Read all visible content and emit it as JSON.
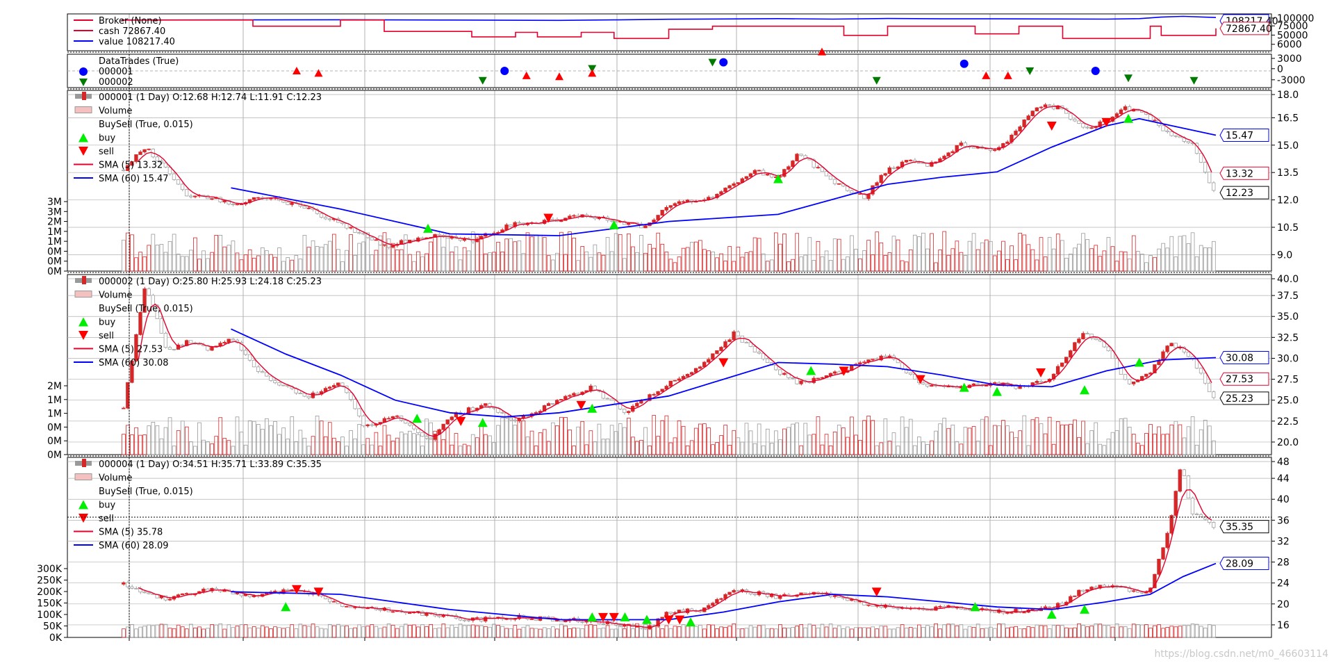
{
  "watermark": "https://blog.csdn.net/m0_46603114",
  "colors": {
    "up": "#d62728",
    "down": "#a0a0a0",
    "sma_fast": "#e4002b",
    "sma_slow": "#0000ff",
    "buy": "#00ee00",
    "sell": "#ff0000",
    "trade_buy": "#0000ff",
    "trade_sell": "#007a00",
    "cash": "#e4002b",
    "value": "#0000ff",
    "volume_up": "#d62728",
    "volume_down": "#999999",
    "grid": "#b0b0b0"
  },
  "chart_data": [
    {
      "type": "line",
      "panel": "broker",
      "legend": [
        "Broker (None)",
        "cash 72867.40",
        "value 108217.40"
      ],
      "yticks": [
        "100000",
        "75000",
        "50000",
        "6000"
      ],
      "ylim": [
        0,
        120000
      ],
      "last_labels": [
        "108217.40",
        "72867.40"
      ],
      "series": [
        {
          "name": "value",
          "x": [
            0,
            0.1,
            0.2,
            0.3,
            0.4,
            0.45,
            0.5,
            0.55,
            0.6,
            0.65,
            0.7,
            0.75,
            0.8,
            0.85,
            0.9,
            0.93,
            0.95,
            0.97,
            1.0
          ],
          "y": [
            100000,
            100500,
            101000,
            100000,
            99000,
            100500,
            102500,
            103500,
            104500,
            103000,
            105000,
            104000,
            104000,
            103500,
            103000,
            104500,
            109500,
            112000,
            108217
          ]
        },
        {
          "name": "cash",
          "x": [
            0,
            0.1,
            0.12,
            0.18,
            0.2,
            0.22,
            0.24,
            0.3,
            0.32,
            0.36,
            0.38,
            0.42,
            0.45,
            0.48,
            0.5,
            0.54,
            0.57,
            0.62,
            0.66,
            0.7,
            0.73,
            0.78,
            0.82,
            0.86,
            0.9,
            0.94,
            0.95,
            1.0
          ],
          "y": [
            100000,
            100000,
            80000,
            80000,
            100000,
            100000,
            63000,
            63000,
            45000,
            60000,
            45000,
            60000,
            40000,
            40000,
            70000,
            80000,
            80000,
            80000,
            50000,
            80000,
            80000,
            55000,
            80000,
            40000,
            40000,
            80000,
            50000,
            72867
          ]
        }
      ]
    },
    {
      "type": "scatter",
      "panel": "datatrades",
      "legend": [
        "DataTrades (True)",
        "000001",
        "000002"
      ],
      "yticks": [
        "3000",
        "0",
        "-3000"
      ],
      "ylim": [
        -3500,
        3500
      ],
      "series": [
        {
          "name": "000001",
          "marker": "circle",
          "x": [
            0.35,
            0.55,
            0.77,
            0.89
          ],
          "y": [
            0,
            1800,
            1500,
            0
          ]
        },
        {
          "name": "000002",
          "marker": "triangle-down",
          "x": [
            0.33,
            0.43,
            0.54,
            0.69,
            0.83,
            0.92,
            0.98
          ],
          "y": [
            -2000,
            500,
            1800,
            -2000,
            0,
            -1500,
            -2000
          ]
        },
        {
          "name": "buy",
          "marker": "triangle-up",
          "x": [
            0.16,
            0.18,
            0.37,
            0.4,
            0.43,
            0.64,
            0.79,
            0.81
          ],
          "y": [
            0,
            -500,
            -1000,
            -1200,
            -500,
            4000,
            -1000,
            -1000
          ]
        }
      ]
    },
    {
      "type": "candlestick",
      "panel": "000001",
      "legend": [
        "000001 (1 Day) O:12.68 H:12.74 L:11.91 C:12.23",
        "Volume",
        "BuySell (True, 0.015)",
        "buy",
        "sell",
        "SMA (5) 13.32",
        "SMA (60) 15.47"
      ],
      "yticks": [
        "18.0",
        "16.5",
        "15.0",
        "13.5",
        "12.0",
        "10.5",
        "9.0"
      ],
      "ylim": [
        7.8,
        18.0
      ],
      "vol_ticks": [
        "3M",
        "3M",
        "2M",
        "1M",
        "1M",
        "0M",
        "0M",
        "0M"
      ],
      "last_labels": [
        "15.47",
        "13.32",
        "12.23"
      ],
      "path_x": [
        0,
        0.02,
        0.04,
        0.06,
        0.08,
        0.1,
        0.13,
        0.16,
        0.2,
        0.24,
        0.28,
        0.32,
        0.36,
        0.38,
        0.42,
        0.46,
        0.48,
        0.5,
        0.54,
        0.58,
        0.6,
        0.62,
        0.65,
        0.68,
        0.7,
        0.72,
        0.74,
        0.77,
        0.8,
        0.82,
        0.84,
        0.86,
        0.88,
        0.9,
        0.92,
        0.94,
        0.96,
        0.98,
        1.0
      ],
      "path_y": [
        13.5,
        14.8,
        13.5,
        12.0,
        12.0,
        11.5,
        12.0,
        11.5,
        10.5,
        9.2,
        9.8,
        9.5,
        10.5,
        10.5,
        11.0,
        10.5,
        10.3,
        11.5,
        12.0,
        13.5,
        13.0,
        14.5,
        12.8,
        12.0,
        13.5,
        14.0,
        13.8,
        15.0,
        14.5,
        15.8,
        17.2,
        17.0,
        15.8,
        16.2,
        17.0,
        16.5,
        15.5,
        15.0,
        12.23
      ],
      "sma_slow_x": [
        0.1,
        0.2,
        0.3,
        0.4,
        0.5,
        0.6,
        0.7,
        0.75,
        0.8,
        0.85,
        0.9,
        0.93,
        0.96,
        1.0
      ],
      "sma_slow_y": [
        12.5,
        11.3,
        9.9,
        9.8,
        10.6,
        11.0,
        12.7,
        13.1,
        13.4,
        14.8,
        16.0,
        16.4,
        16.0,
        15.47
      ],
      "buy_x": [
        0.28,
        0.45,
        0.6,
        0.92
      ],
      "buy_y": [
        10.2,
        10.4,
        13.0,
        16.4
      ],
      "sell_x": [
        0.39,
        0.85,
        0.9
      ],
      "sell_y": [
        10.8,
        16.0,
        16.2
      ]
    },
    {
      "type": "candlestick",
      "panel": "000002",
      "legend": [
        "000002 (1 Day) O:25.80 H:25.93 L:24.18 C:25.23",
        "Volume",
        "BuySell (True, 0.015)",
        "buy",
        "sell",
        "SMA (5) 27.53",
        "SMA (60) 30.08"
      ],
      "yticks": [
        "40.0",
        "37.5",
        "35.0",
        "32.5",
        "30.0",
        "27.5",
        "25.0",
        "22.5",
        "20.0"
      ],
      "ylim": [
        18.5,
        40.0
      ],
      "vol_ticks": [
        "2M",
        "1M",
        "1M",
        "0M",
        "0M",
        "0M"
      ],
      "last_labels": [
        "30.08",
        "27.53",
        "25.23"
      ],
      "path_x": [
        0,
        0.02,
        0.04,
        0.06,
        0.08,
        0.1,
        0.12,
        0.14,
        0.17,
        0.2,
        0.22,
        0.25,
        0.28,
        0.3,
        0.33,
        0.36,
        0.4,
        0.43,
        0.46,
        0.5,
        0.53,
        0.56,
        0.6,
        0.62,
        0.65,
        0.7,
        0.73,
        0.76,
        0.8,
        0.82,
        0.85,
        0.88,
        0.9,
        0.92,
        0.94,
        0.96,
        0.98,
        1.0
      ],
      "path_y": [
        24.0,
        39.0,
        31.0,
        32.0,
        31.0,
        32.5,
        29.0,
        27.0,
        25.5,
        27.0,
        22.0,
        23.0,
        20.0,
        23.0,
        24.5,
        22.5,
        25.0,
        26.5,
        23.5,
        27.0,
        29.0,
        33.0,
        28.5,
        27.0,
        28.0,
        30.5,
        27.0,
        26.5,
        27.0,
        26.5,
        27.5,
        33.0,
        31.5,
        27.0,
        28.0,
        32.0,
        30.0,
        25.23
      ],
      "sma_slow_x": [
        0.1,
        0.15,
        0.2,
        0.25,
        0.3,
        0.35,
        0.4,
        0.45,
        0.5,
        0.55,
        0.6,
        0.65,
        0.7,
        0.75,
        0.8,
        0.85,
        0.9,
        0.95,
        1.0
      ],
      "sma_slow_y": [
        33.5,
        30.5,
        28.0,
        25.0,
        23.5,
        23.0,
        23.5,
        24.5,
        25.5,
        27.5,
        29.5,
        29.3,
        29.0,
        28.0,
        26.8,
        26.6,
        28.5,
        29.8,
        30.08
      ],
      "buy_x": [
        0.27,
        0.33,
        0.43,
        0.63,
        0.77,
        0.8,
        0.88,
        0.93
      ],
      "buy_y": [
        22.8,
        22.3,
        24.0,
        28.5,
        26.5,
        26.0,
        26.2,
        29.5
      ],
      "sell_x": [
        0.31,
        0.42,
        0.55,
        0.66,
        0.73,
        0.84
      ],
      "sell_y": [
        22.5,
        24.4,
        29.5,
        28.5,
        27.5,
        28.3
      ]
    },
    {
      "type": "candlestick",
      "panel": "000004",
      "legend": [
        "000004 (1 Day) O:34.51 H:35.71 L:33.89 C:35.35",
        "Volume",
        "BuySell (True, 0.015)",
        "buy",
        "sell",
        "SMA (5) 35.78",
        "SMA (60) 28.09"
      ],
      "yticks": [
        "48",
        "44",
        "40",
        "36",
        "32",
        "28",
        "24",
        "20",
        "16"
      ],
      "ylim": [
        13.5,
        49.0
      ],
      "vol_ticks": [
        "300K",
        "250K",
        "200K",
        "150K",
        "100K",
        "50K",
        "0K"
      ],
      "last_labels": [
        "35.35",
        "28.09"
      ],
      "path_x": [
        0,
        0.04,
        0.08,
        0.12,
        0.16,
        0.2,
        0.24,
        0.28,
        0.32,
        0.36,
        0.4,
        0.44,
        0.48,
        0.5,
        0.53,
        0.56,
        0.6,
        0.64,
        0.68,
        0.72,
        0.76,
        0.8,
        0.84,
        0.86,
        0.88,
        0.9,
        0.92,
        0.94,
        0.96,
        0.97,
        0.98,
        1.0
      ],
      "path_y": [
        24.0,
        21.0,
        23.0,
        21.5,
        23.0,
        20.0,
        19.0,
        18.0,
        17.0,
        17.5,
        17.0,
        16.5,
        15.0,
        18.5,
        19.0,
        23.0,
        21.5,
        22.5,
        20.0,
        19.0,
        19.5,
        18.5,
        19.0,
        20.0,
        23.0,
        23.5,
        23.0,
        22.0,
        36.0,
        48.0,
        38.0,
        35.35
      ],
      "sma_slow_x": [
        0.1,
        0.2,
        0.3,
        0.4,
        0.5,
        0.55,
        0.6,
        0.65,
        0.7,
        0.75,
        0.8,
        0.85,
        0.9,
        0.94,
        0.97,
        1.0
      ],
      "sma_slow_y": [
        22.5,
        22.0,
        19.0,
        17.0,
        17.0,
        18.5,
        20.5,
        22.0,
        21.5,
        20.5,
        19.5,
        19.0,
        20.5,
        22.0,
        25.5,
        28.09
      ],
      "buy_x": [
        0.15,
        0.43,
        0.46,
        0.48,
        0.52,
        0.78,
        0.85,
        0.88
      ],
      "buy_y": [
        19.5,
        17.5,
        17.5,
        17.0,
        16.5,
        19.5,
        18.0,
        19.0
      ],
      "sell_x": [
        0.16,
        0.18,
        0.44,
        0.45,
        0.5,
        0.51,
        0.69
      ],
      "sell_y": [
        23.0,
        22.5,
        17.5,
        17.5,
        17.0,
        17.0,
        22.5
      ]
    }
  ]
}
